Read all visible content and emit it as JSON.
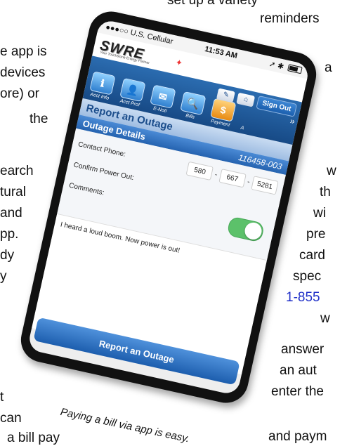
{
  "article": {
    "lines": [
      {
        "text": "set  up  a  variety"
      },
      {
        "text": "reminders"
      },
      {
        "text": "e app is"
      },
      {
        "text": "devices"
      },
      {
        "text": "ore) or"
      },
      {
        "text": "the"
      },
      {
        "text": "earch"
      },
      {
        "text": "tural"
      },
      {
        "text": "and"
      },
      {
        "text": "pp."
      },
      {
        "text": "dy"
      },
      {
        "text": "y"
      },
      {
        "text": "a"
      },
      {
        "text": "w"
      },
      {
        "text": "th"
      },
      {
        "text": "wi"
      },
      {
        "text": "pre"
      },
      {
        "text": "card"
      },
      {
        "text": "spec"
      },
      {
        "text": "1-855"
      },
      {
        "text": "w"
      },
      {
        "text": "answer"
      },
      {
        "text": "an  aut"
      },
      {
        "text": "enter the"
      },
      {
        "text": "and paym"
      },
      {
        "text": "can"
      },
      {
        "text": "t"
      },
      {
        "text": "a  bill pay"
      }
    ],
    "caption": "Paying a bill via app is easy."
  },
  "status_bar": {
    "carrier": "●●●○○ U.S. Cellular",
    "wifi": "wifi-icon",
    "time": "11:53 AM",
    "right_icons": "➚ ✱"
  },
  "brand": {
    "logo": "SWRE",
    "tagline": "Your Touchstone Energy Partner"
  },
  "nav_top": {
    "sign_out": "Sign Out"
  },
  "nav_items": [
    {
      "label": "Acct Info",
      "icon": "ℹ"
    },
    {
      "label": "Acct Prof",
      "icon": "👤"
    },
    {
      "label": "E-Noti",
      "icon": "✉"
    },
    {
      "label": "Bills",
      "icon": "🔍"
    },
    {
      "label": "Payment",
      "icon": "$"
    },
    {
      "label": "A",
      "icon": ""
    }
  ],
  "page": {
    "title": "Report an Outage",
    "section": "Outage Details",
    "account": "116458-003"
  },
  "form": {
    "contact_label": "Contact Phone:",
    "phone": [
      "580",
      "667",
      "5281"
    ],
    "confirm_label": "Confirm Power Out:",
    "confirm_on": true,
    "comments_label": "Comments:",
    "comments": "I heard a loud boom. Now power is out!"
  },
  "submit_label": "Report an Outage"
}
